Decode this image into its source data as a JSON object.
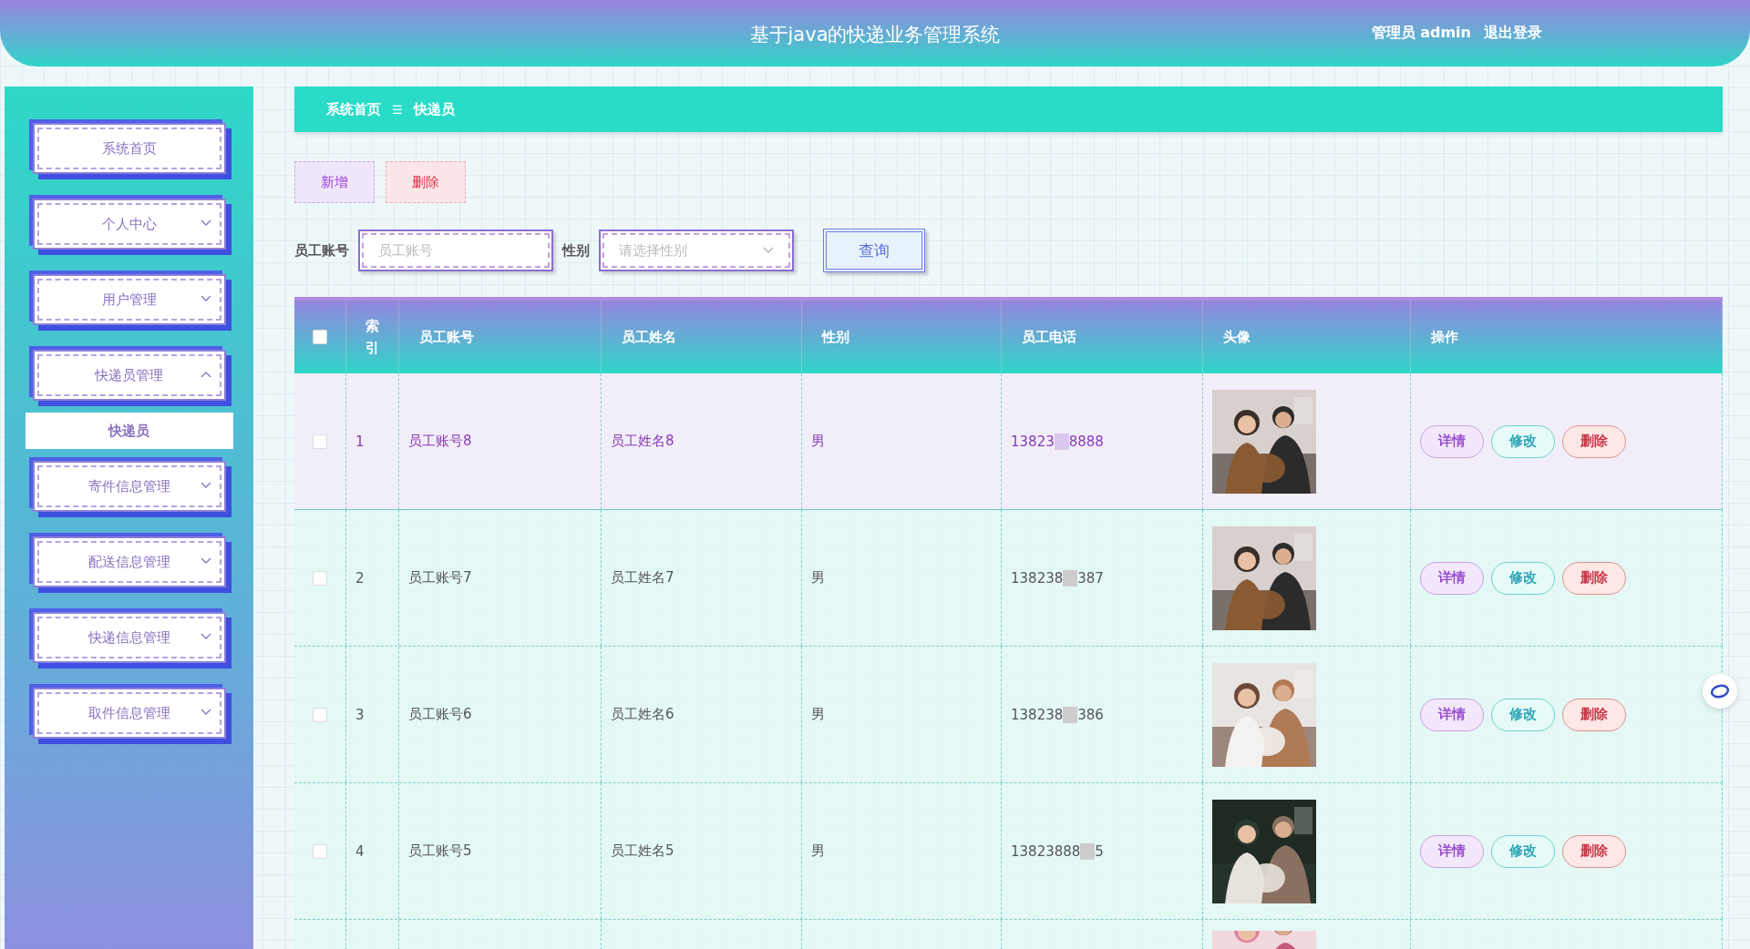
{
  "header": {
    "title": "基于java的快递业务管理系统",
    "user": "管理员 admin",
    "logout": "退出登录"
  },
  "sidebar": {
    "items": [
      {
        "kind": "link",
        "label": "系统首页"
      },
      {
        "kind": "menu",
        "label": "个人中心",
        "expanded": false
      },
      {
        "kind": "menu",
        "label": "用户管理",
        "expanded": false
      },
      {
        "kind": "menu",
        "label": "快递员管理",
        "expanded": true,
        "children": [
          {
            "label": "快递员",
            "selected": true
          }
        ]
      },
      {
        "kind": "menu",
        "label": "寄件信息管理",
        "expanded": false
      },
      {
        "kind": "menu",
        "label": "配送信息管理",
        "expanded": false
      },
      {
        "kind": "menu",
        "label": "快递信息管理",
        "expanded": false
      },
      {
        "kind": "menu",
        "label": "取件信息管理",
        "expanded": false
      }
    ]
  },
  "breadcrumb": {
    "home": "系统首页",
    "separator": "☰",
    "current": "快递员"
  },
  "actions": {
    "add": "新增",
    "delete": "删除"
  },
  "search": {
    "account_label": "员工账号",
    "account_placeholder": "员工账号",
    "gender_label": "性别",
    "gender_placeholder": "请选择性别",
    "button": "查询"
  },
  "table": {
    "columns": [
      "索引",
      "员工账号",
      "员工姓名",
      "性别",
      "员工电话",
      "头像",
      "操作"
    ],
    "select_all": false,
    "rows": [
      {
        "selected": true,
        "checked": false,
        "index": "1",
        "account": "员工账号8",
        "name": "员工姓名8",
        "gender": "男",
        "phone_start": "13823",
        "phone_end": "8888",
        "avatar": {
          "kind": "picture"
        },
        "buttons": [
          "详情",
          "修改",
          "删除"
        ]
      },
      {
        "selected": false,
        "checked": false,
        "index": "2",
        "account": "员工账号7",
        "name": "员工姓名7",
        "gender": "男",
        "phone_start": "138238",
        "phone_end": "387",
        "avatar": {
          "kind": "picture"
        },
        "buttons": [
          "详情",
          "修改",
          "删除"
        ]
      },
      {
        "selected": false,
        "checked": false,
        "index": "3",
        "account": "员工账号6",
        "name": "员工姓名6",
        "gender": "男",
        "phone_start": "138238",
        "phone_end": "386",
        "avatar": {
          "kind": "picture"
        },
        "buttons": [
          "详情",
          "修改",
          "删除"
        ]
      },
      {
        "selected": false,
        "checked": false,
        "index": "4",
        "account": "员工账号5",
        "name": "员工姓名5",
        "gender": "男",
        "phone_start": "13823888",
        "phone_end": "5",
        "avatar": {
          "kind": "picture"
        },
        "buttons": [
          "详情",
          "修改",
          "删除"
        ]
      },
      {
        "avatar": {
          "kind": "picture"
        }
      }
    ]
  }
}
